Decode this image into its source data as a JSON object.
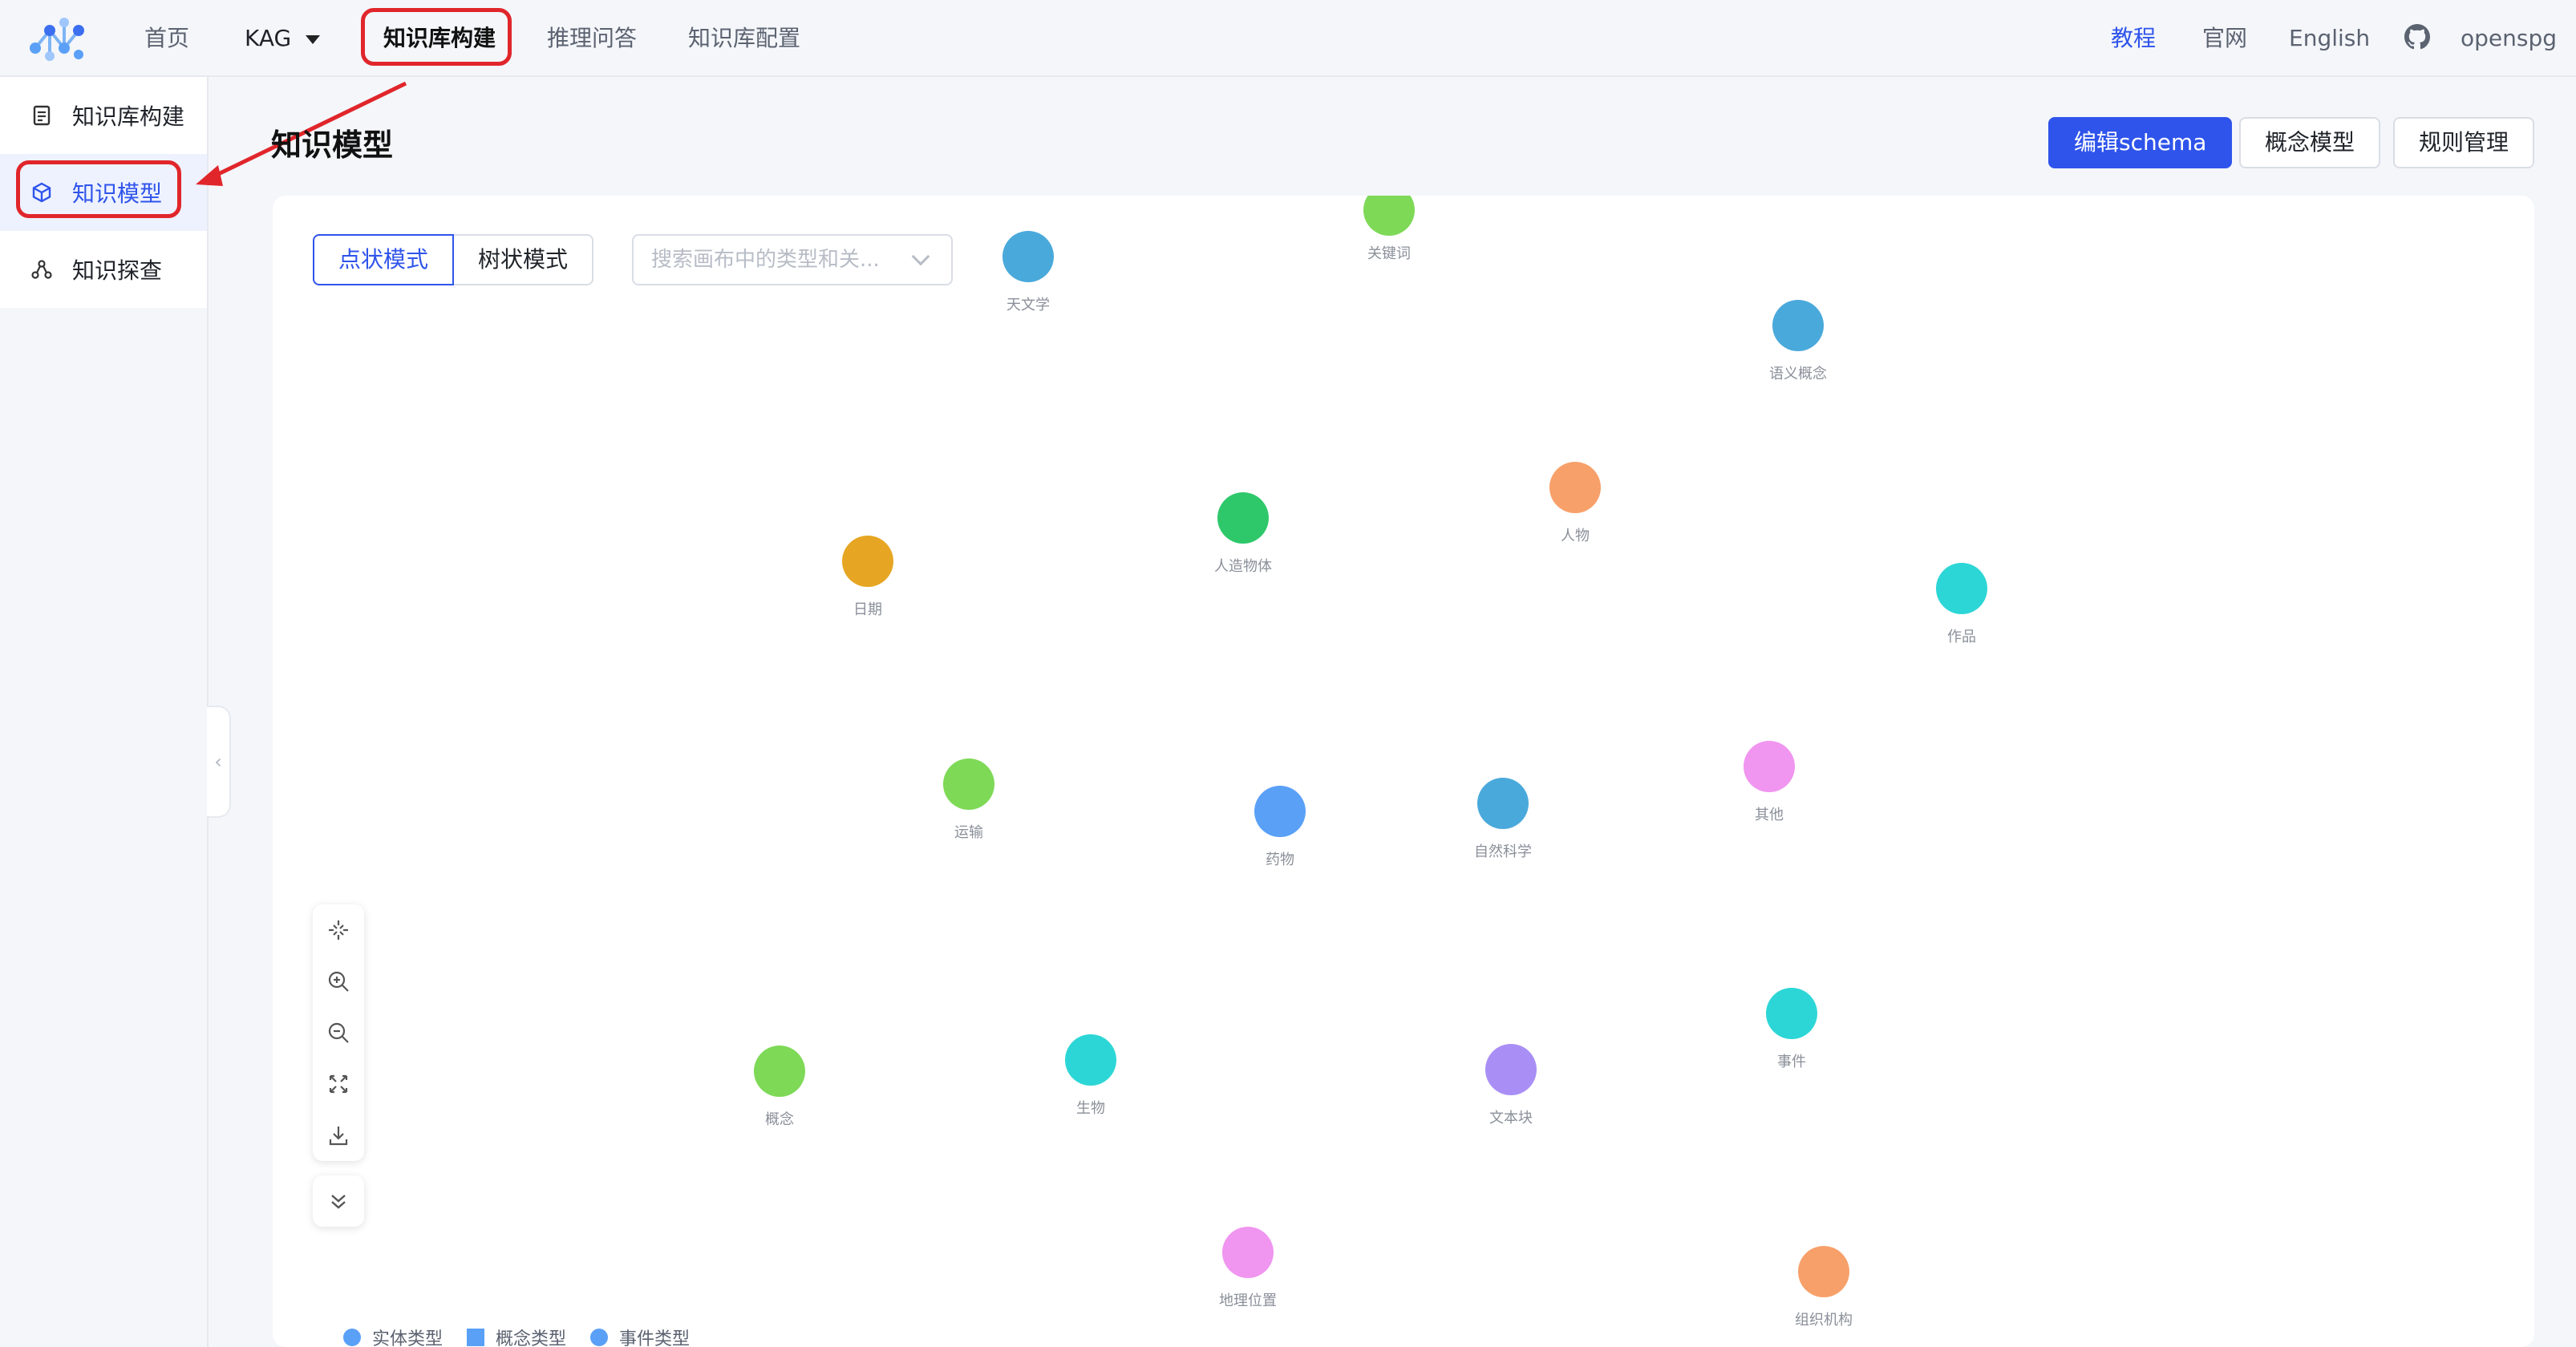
{
  "header": {
    "nav": {
      "home": "首页",
      "project": "KAG",
      "kb_build": "知识库构建",
      "reasoning_qa": "推理问答",
      "kb_config": "知识库配置"
    },
    "right": {
      "tutorial": "教程",
      "official_site": "官网",
      "language": "English",
      "github_user": "openspg"
    }
  },
  "sidebar": {
    "items": [
      {
        "label": "知识库构建",
        "icon": "document-icon"
      },
      {
        "label": "知识模型",
        "icon": "cube-icon"
      },
      {
        "label": "知识探查",
        "icon": "graph-nodes-icon"
      }
    ]
  },
  "page": {
    "title": "知识模型",
    "actions": {
      "edit_schema": "编辑schema",
      "concept_model": "概念模型",
      "rule_manage": "规则管理"
    }
  },
  "canvas": {
    "mode_point": "点状模式",
    "mode_tree": "树状模式",
    "search_placeholder": "搜索画布中的类型和关...",
    "nodes": [
      {
        "label": "关键词",
        "color": "#7ed957"
      },
      {
        "label": "天文学",
        "color": "#4aa9db"
      },
      {
        "label": "语义概念",
        "color": "#4aa9db"
      },
      {
        "label": "人造物体",
        "color": "#2ec86b"
      },
      {
        "label": "人物",
        "color": "#f7a06a"
      },
      {
        "label": "日期",
        "color": "#e6a623"
      },
      {
        "label": "作品",
        "color": "#2dd6d6"
      },
      {
        "label": "运输",
        "color": "#7ed957"
      },
      {
        "label": "药物",
        "color": "#5aa0f7"
      },
      {
        "label": "自然科学",
        "color": "#4aa9db"
      },
      {
        "label": "其他",
        "color": "#f095f0"
      },
      {
        "label": "事件",
        "color": "#2dd6d6"
      },
      {
        "label": "概念",
        "color": "#7ed957"
      },
      {
        "label": "生物",
        "color": "#2dd6d6"
      },
      {
        "label": "文本块",
        "color": "#a98ff5"
      },
      {
        "label": "地理位置",
        "color": "#f095f0"
      },
      {
        "label": "组织机构",
        "color": "#f7a06a"
      }
    ],
    "legend": [
      {
        "label": "实体类型",
        "color": "#5aa0f7",
        "shape": "circle"
      },
      {
        "label": "概念类型",
        "color": "#5aa0f7",
        "shape": "square"
      },
      {
        "label": "事件类型",
        "color": "#5aa0f7",
        "shape": "circle"
      }
    ],
    "tools": [
      "fit-view-icon",
      "zoom-in-icon",
      "zoom-out-icon",
      "fullscreen-icon",
      "download-icon",
      "expand-down-icon"
    ]
  }
}
